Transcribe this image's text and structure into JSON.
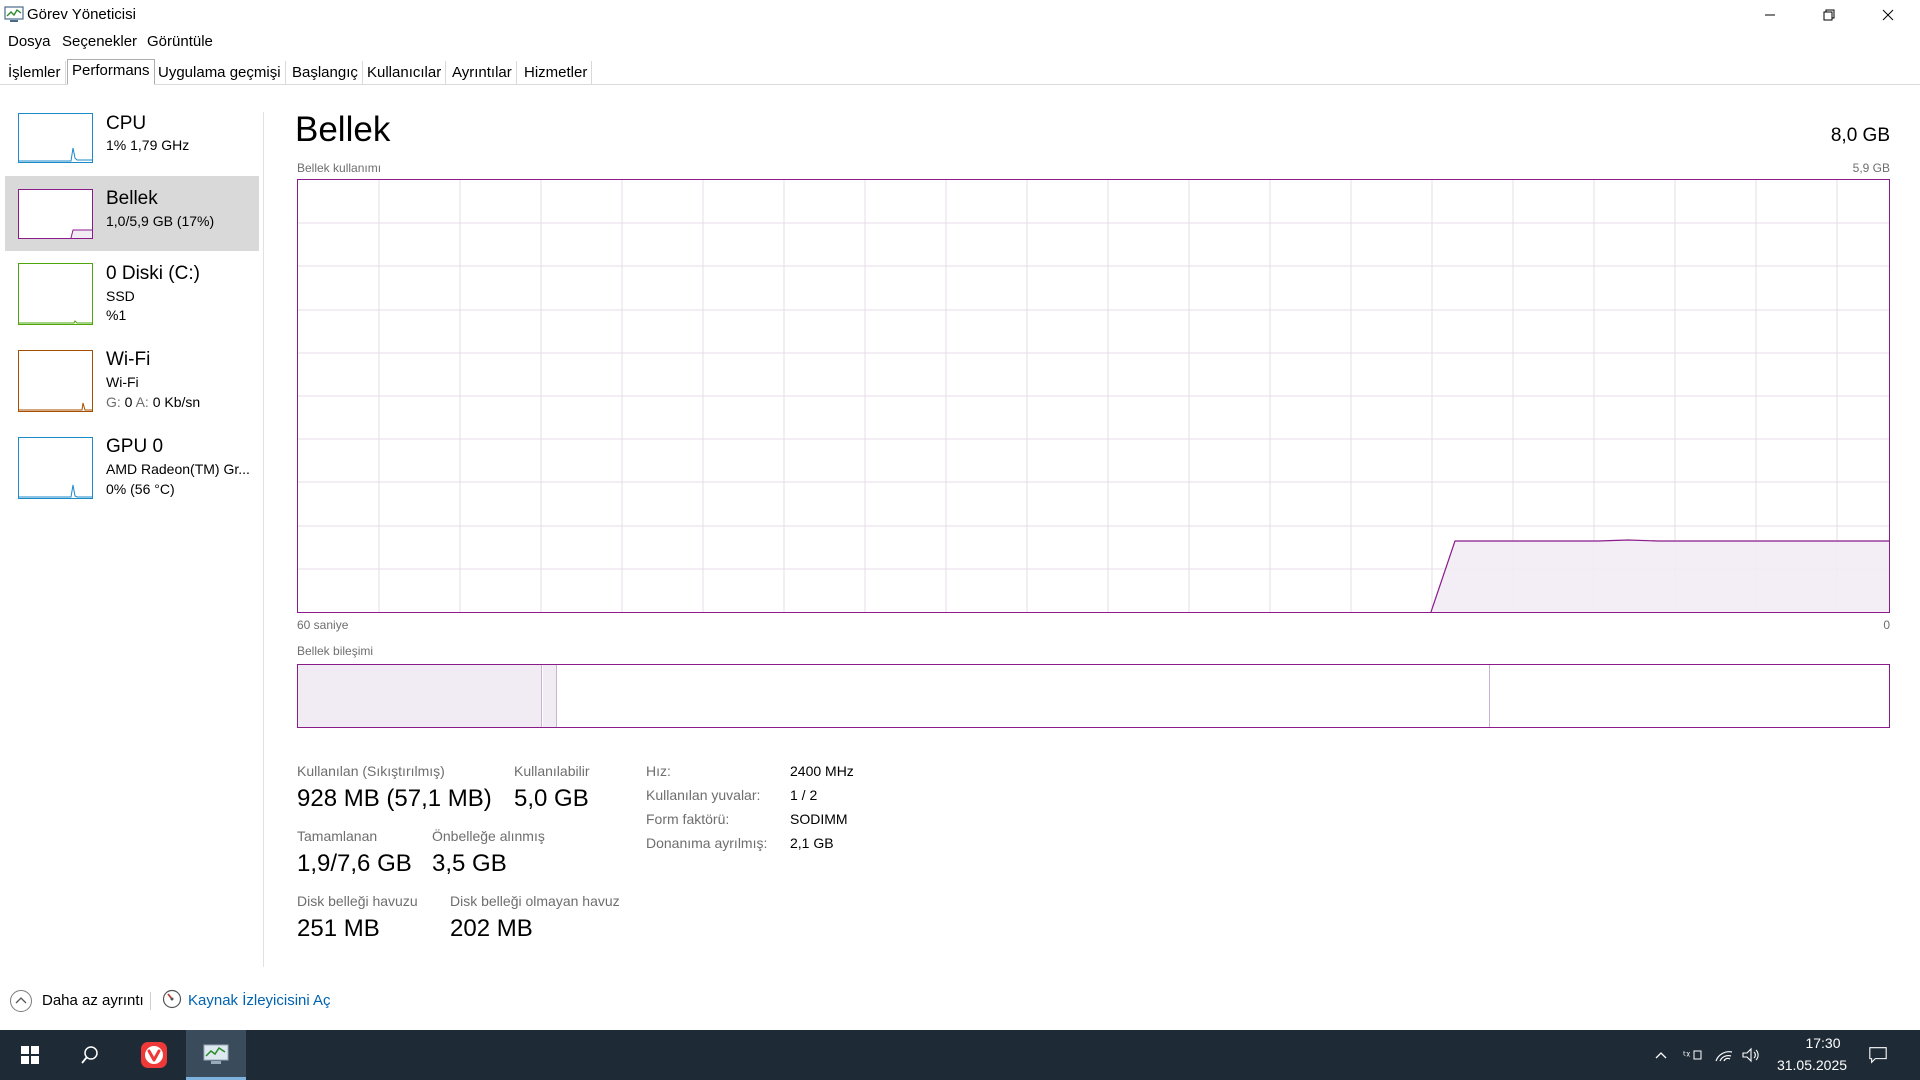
{
  "window": {
    "title": "Görev Yöneticisi",
    "minimize": "—",
    "maximize": "❐",
    "close": "✕"
  },
  "menu": [
    "Dosya",
    "Seçenekler",
    "Görüntüle"
  ],
  "tabs": [
    "İşlemler",
    "Performans",
    "Uygulama geçmişi",
    "Başlangıç",
    "Kullanıcılar",
    "Ayrıntılar",
    "Hizmetler"
  ],
  "sidebar": {
    "items": [
      {
        "title": "CPU",
        "line1": "1%  1,79 GHz",
        "line2": "",
        "color": "#1a8ac9"
      },
      {
        "title": "Bellek",
        "line1": "1,0/5,9 GB (17%)",
        "line2": "",
        "color": "#8b1a8b"
      },
      {
        "title": "0 Diski (C:)",
        "line1": "SSD",
        "line2": "%1",
        "color": "#4da60c"
      },
      {
        "title": "Wi-Fi",
        "line1": "Wi-Fi",
        "line2_prefix_s": "G:",
        "line2_s_val": "0",
        "line2_prefix_r": "A:",
        "line2_r_val": "0 Kb/sn",
        "color": "#a74f01"
      },
      {
        "title": "GPU 0",
        "line1": "AMD Radeon(TM) Gr...",
        "line2": "0%  (56 °C)",
        "color": "#1a8ac9"
      }
    ]
  },
  "main": {
    "title": "Bellek",
    "total": "8,0 GB",
    "usage_label": "Bellek kullanımı",
    "usage_max": "5,9 GB",
    "time_left": "60 saniye",
    "time_right": "0",
    "composition_label": "Bellek bileşimi",
    "accent": "#8b1a8b",
    "fill": "#f1ebf4"
  },
  "stats": {
    "in_use_label": "Kullanılan (Sıkıştırılmış)",
    "in_use_value": "928 MB (57,1 MB)",
    "available_label": "Kullanılabilir",
    "available_value": "5,0 GB",
    "committed_label": "Tamamlanan",
    "committed_value": "1,9/7,6 GB",
    "cached_label": "Önbelleğe alınmış",
    "cached_value": "3,5 GB",
    "paged_label": "Disk belleği havuzu",
    "paged_value": "251 MB",
    "nonpaged_label": "Disk belleği olmayan havuz",
    "nonpaged_value": "202 MB"
  },
  "specs": {
    "speed_label": "Hız:",
    "speed_value": "2400 MHz",
    "slots_label": "Kullanılan yuvalar:",
    "slots_value": "1 / 2",
    "form_label": "Form faktörü:",
    "form_value": "SODIMM",
    "reserved_label": "Donanıma ayrılmış:",
    "reserved_value": "2,1 GB"
  },
  "footer": {
    "fewer_details": "Daha az ayrıntı",
    "open_resource_monitor": "Kaynak İzleyicisini Aç"
  },
  "taskbar": {
    "time": "17:30",
    "date": "31.05.2025"
  }
}
